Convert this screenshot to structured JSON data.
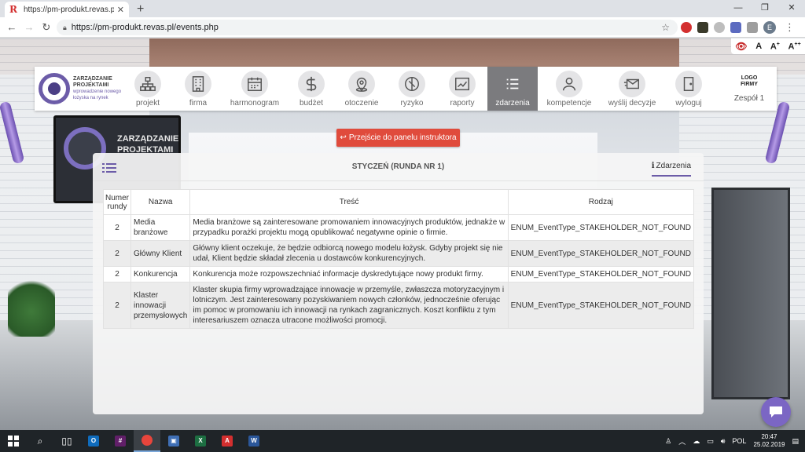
{
  "browser": {
    "tab_title": "https://pm-produkt.revas.pl/eve",
    "url": "https://pm-produkt.revas.pl/events.php"
  },
  "a11y": {
    "a1": "A",
    "a2": "A",
    "a2_sup": "+",
    "a3": "A",
    "a3_sup": "++"
  },
  "brand": {
    "title": "ZARZĄDZANIE PROJEKTAMI",
    "subtitle": "wprowadzenie nowego łożyska na rynek"
  },
  "tv": {
    "text": "ZARZĄDZANIE PROJEKTAMI"
  },
  "nav": {
    "projekt": "projekt",
    "firma": "firma",
    "harmonogram": "harmonogram",
    "budzet": "budżet",
    "otoczenie": "otoczenie",
    "ryzyko": "ryzyko",
    "raporty": "raporty",
    "zdarzenia": "zdarzenia",
    "kompetencje": "kompetencje",
    "wyslij": "wyślij decyzje",
    "wyloguj": "wyloguj"
  },
  "logo_firm": {
    "label": "LOGO FIRMY",
    "team": "Zespół 1"
  },
  "instructor_button": "Przejście do panelu instruktora",
  "panel": {
    "title": "STYCZEŃ (RUNDA NR 1)",
    "tab": "Zdarzenia",
    "tab_icon": "i"
  },
  "table": {
    "headers": {
      "num": "Numer rundy",
      "name": "Nazwa",
      "content": "Treść",
      "kind": "Rodzaj"
    },
    "rows": [
      {
        "num": "2",
        "name": "Media branżowe",
        "content": "Media branżowe są zainteresowane promowaniem innowacyjnych produktów, jednakże w przypadku porażki projektu mogą opublikować negatywne opinie o firmie.",
        "kind": "ENUM_EventType_STAKEHOLDER_NOT_FOUND"
      },
      {
        "num": "2",
        "name": "Główny Klient",
        "content": "Główny klient oczekuje, że będzie odbiorcą nowego modelu łożysk. Gdyby projekt się nie udał, Klient będzie składał zlecenia u dostawców konkurencyjnych.",
        "kind": "ENUM_EventType_STAKEHOLDER_NOT_FOUND"
      },
      {
        "num": "2",
        "name": "Konkurencja",
        "content": "Konkurencja może rozpowszechniać informacje dyskredytujące nowy produkt firmy.",
        "kind": "ENUM_EventType_STAKEHOLDER_NOT_FOUND"
      },
      {
        "num": "2",
        "name": "Klaster innowacji przemysłowych",
        "content": "Klaster skupia firmy wprowadzające innowacje w przemyśle, zwłaszcza motoryzacyjnym i lotniczym. Jest zainteresowany pozyskiwaniem nowych członków, jednocześnie oferując im pomoc w promowaniu ich innowacji na rynkach zagranicznych. Koszt konfliktu z tym interesariuszem oznacza utracone możliwości promocji.",
        "kind": "ENUM_EventType_STAKEHOLDER_NOT_FOUND"
      }
    ]
  },
  "taskbar": {
    "lang": "POL",
    "time": "20:47",
    "date": "25.02.2019"
  },
  "colors": {
    "accent": "#6c5ca8",
    "danger": "#e04b3c",
    "active_nav": "#7b7b7e"
  }
}
